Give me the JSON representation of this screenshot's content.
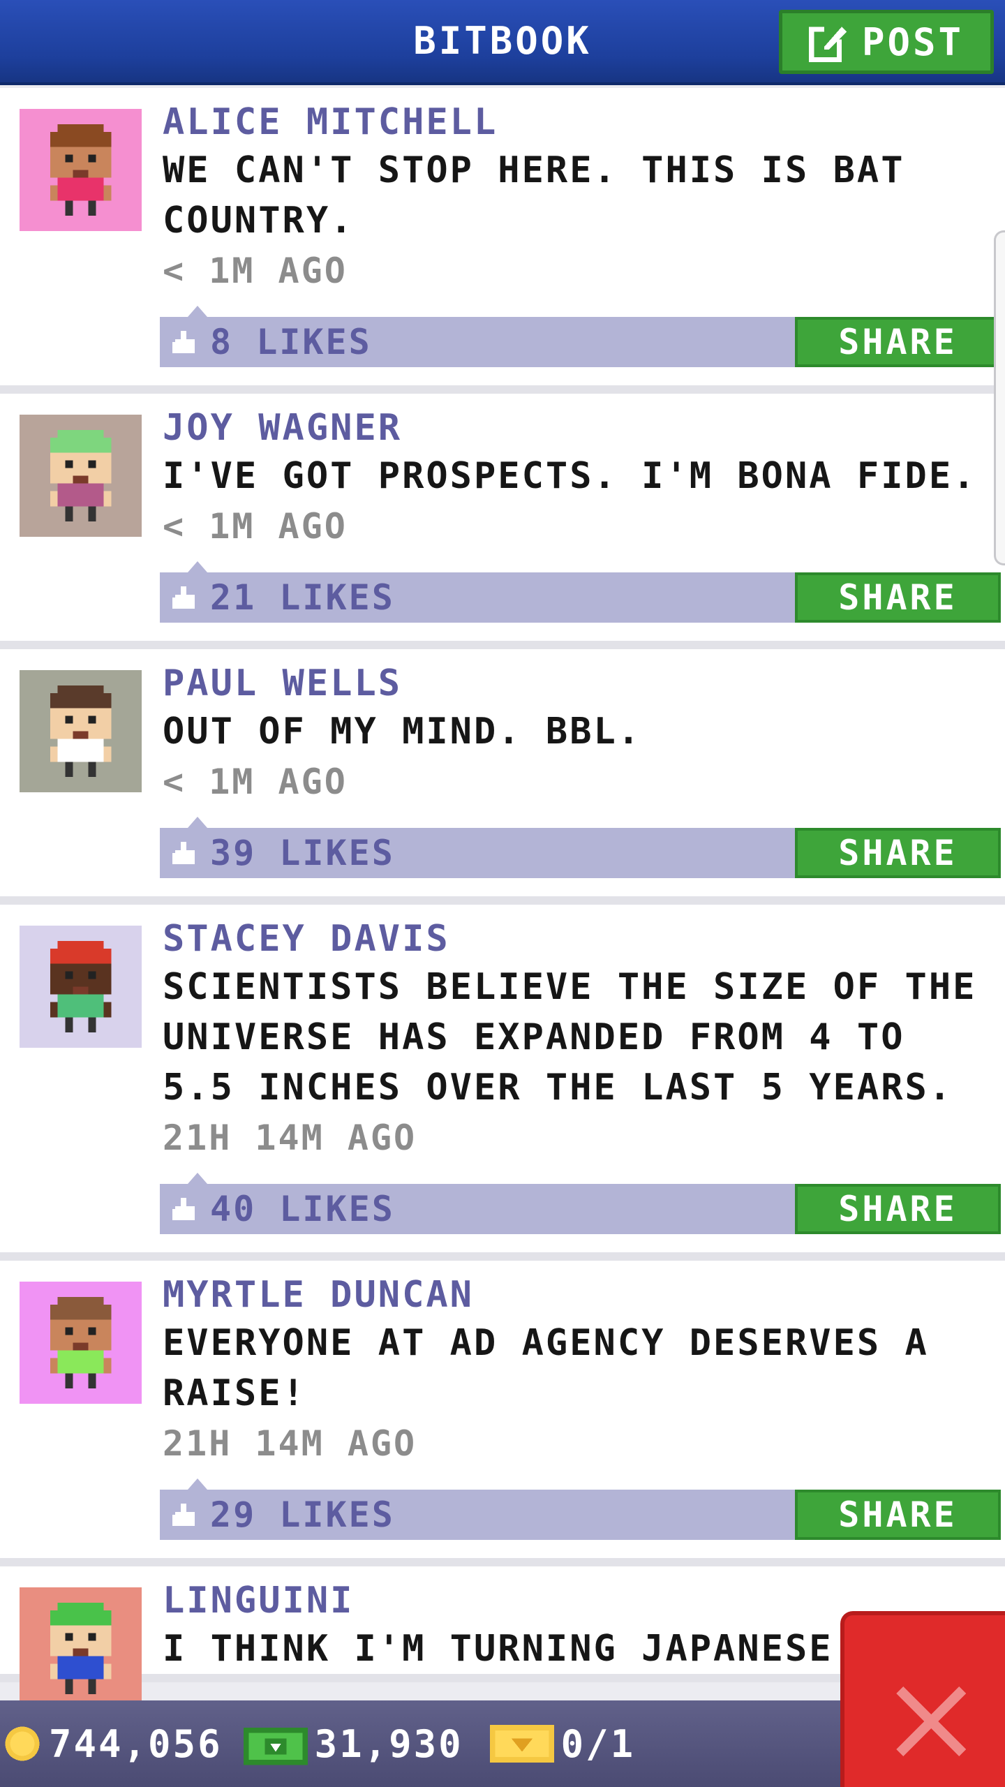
{
  "header": {
    "title": "BITBOOK",
    "post_label": "POST"
  },
  "posts": [
    {
      "author": "ALICE MITCHELL",
      "message": "WE CAN'T STOP HERE. THIS IS BAT COUNTRY.",
      "time": "< 1M AGO",
      "likes": "8 LIKES",
      "share_label": "SHARE",
      "avatar_bg": "#f58fd0",
      "shirt": "#e8336a",
      "hair": "#8a4a22",
      "skin": "#c9855c"
    },
    {
      "author": "JOY WAGNER",
      "message": "I'VE GOT PROSPECTS. I'M BONA FIDE.",
      "time": "< 1M AGO",
      "likes": "21 LIKES",
      "share_label": "SHARE",
      "avatar_bg": "#b8a49a",
      "shirt": "#b35a8a",
      "hair": "#7ed67e",
      "skin": "#f2cfa6"
    },
    {
      "author": "PAUL WELLS",
      "message": "OUT OF MY MIND. BBL.",
      "time": "< 1M AGO",
      "likes": "39 LIKES",
      "share_label": "SHARE",
      "avatar_bg": "#a4a697",
      "shirt": "#ffffff",
      "hair": "#5a3b2b",
      "skin": "#f2cfa6"
    },
    {
      "author": "STACEY DAVIS",
      "message": "SCIENTISTS BELIEVE THE SIZE OF THE UNIVERSE HAS EXPANDED FROM 4 TO 5.5 INCHES OVER THE LAST 5 YEARS.",
      "time": "21H 14M AGO",
      "likes": "40 LIKES",
      "share_label": "SHARE",
      "avatar_bg": "#d8d2ec",
      "shirt": "#4fbf7a",
      "hair": "#d93a2a",
      "skin": "#5a3320"
    },
    {
      "author": "MYRTLE DUNCAN",
      "message": "EVERYONE AT AD AGENCY DESERVES A RAISE!",
      "time": "21H 14M AGO",
      "likes": "29 LIKES",
      "share_label": "SHARE",
      "avatar_bg": "#f093f4",
      "shirt": "#8ae85a",
      "hair": "#8a5a3b",
      "skin": "#c9855c"
    },
    {
      "author": "LINGUINI",
      "message": "I THINK I'M TURNING JAPANESE.",
      "time": "",
      "likes": "",
      "share_label": "",
      "avatar_bg": "#e98e80",
      "shirt": "#2e4fd0",
      "hair": "#49c24a",
      "skin": "#f2cfa6"
    }
  ],
  "bottom_bar": {
    "coins": "744,056",
    "bux": "31,930",
    "tickets": "0/1"
  },
  "colors": {
    "header_blue": "#1d3f9c",
    "green_button": "#3ea53a",
    "like_bar": "#b3b4d6",
    "author_purple": "#5d5ca0",
    "close_red": "#e02a2a"
  },
  "icons": {
    "post": "edit-icon",
    "like": "thumbs-up-icon",
    "coin": "coin-icon",
    "bux": "bux-icon",
    "ticket": "ticket-icon",
    "close": "close-icon"
  }
}
